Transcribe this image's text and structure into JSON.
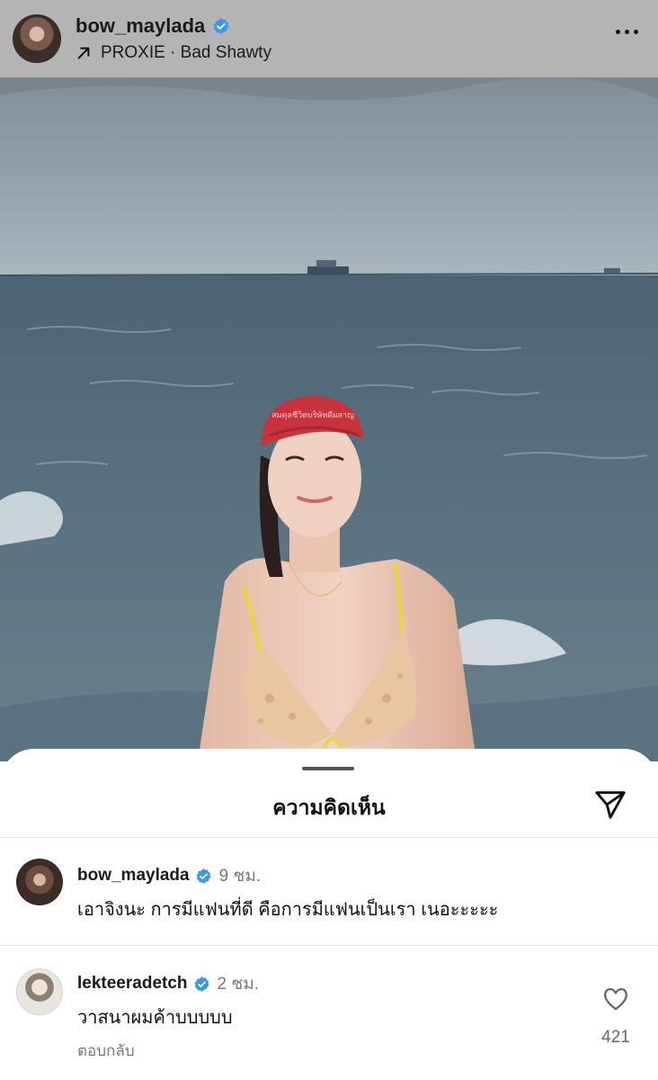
{
  "header": {
    "username": "bow_maylada",
    "music": "PROXIE · Bad Shawty",
    "avatar_icon": "profile-avatar",
    "more_icon": "more-horizontal-icon"
  },
  "photo": {
    "cap_text": "สมดุลชีวิตบริษัทดีผลาญ",
    "description_icon": "post-photo"
  },
  "sheet": {
    "title": "ความคิดเห็น",
    "send_icon": "paper-plane-icon"
  },
  "comments": [
    {
      "username": "bow_maylada",
      "verified": true,
      "time": "9 ชม.",
      "text": "เอาจิงนะ การมีแฟนที่ดี คือการมีแฟนเป็นเรา เนอะะะะะ"
    },
    {
      "username": "lekteeradetch",
      "verified": true,
      "time": "2 ชม.",
      "text": "วาสนาผมค้าบบบบบ",
      "reply_label": "ตอบกลับ",
      "likes": "421"
    }
  ],
  "colors": {
    "verified_blue": "#3897f0",
    "header_bg": "#b4b4b4",
    "sea": "#5c7381",
    "sky": "#a9b4bb"
  }
}
